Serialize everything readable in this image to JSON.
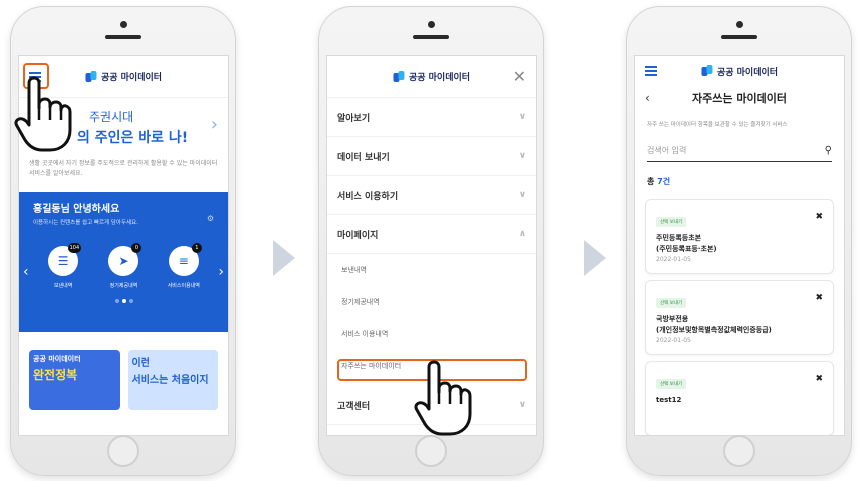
{
  "logo_text": "공공 마이데이터",
  "screen1": {
    "hero_line1": "주권시대",
    "hero_line2": "의 주인은 바로 나!",
    "hero_desc": "생활 곳곳에서 자기 정보를 주도적으로 관리하게 활용할 수 있는 마이데이터 서비스를 알아보세요.",
    "card_title": "홍길동님 안녕하세요",
    "card_sub": "이용하시는 컨텐츠를 쉽고 빠르게 담아두세요.",
    "icons": [
      {
        "label": "보낸내역",
        "badge": "104"
      },
      {
        "label": "정기제공내역",
        "badge": "0"
      },
      {
        "label": "서비스이용내역",
        "badge": "1"
      }
    ],
    "thumb1_l1": "공공 마이데이터",
    "thumb1_l2": "완전정복",
    "thumb2_l1": "이런",
    "thumb2_l2": "서비스는 처음이지"
  },
  "screen2": {
    "menu": [
      "알아보기",
      "데이터 보내기",
      "서비스 이용하기",
      "마이페이지"
    ],
    "sub_items": [
      "보낸내역",
      "정기제공내역",
      "서비스 이용내역",
      "자주쓰는 마이데이터"
    ],
    "last_menu": "고객센터"
  },
  "screen3": {
    "title": "자주쓰는 마이데이터",
    "help": "자주 쓰는 마이데이터 항목을 보관할 수 있는 즐겨찾기 서비스",
    "search_placeholder": "검색어 입력",
    "count_prefix": "총 ",
    "count_value": "7건",
    "items": [
      {
        "tag": "선택 보내기",
        "name1": "주민등록등초본",
        "name2": "(주민등록표등·초본)",
        "date": "2022-01-05"
      },
      {
        "tag": "선택 보내기",
        "name1": "국방부전용",
        "name2": "(개인정보및항목별측정값체력인증등급)",
        "date": "2022-01-05"
      },
      {
        "tag": "선택 보내기",
        "name1": "test12",
        "name2": "",
        "date": ""
      }
    ]
  },
  "colors": {
    "accent": "#1e63d6",
    "highlight": "#e8641a",
    "arrow": "#cfd5de"
  }
}
